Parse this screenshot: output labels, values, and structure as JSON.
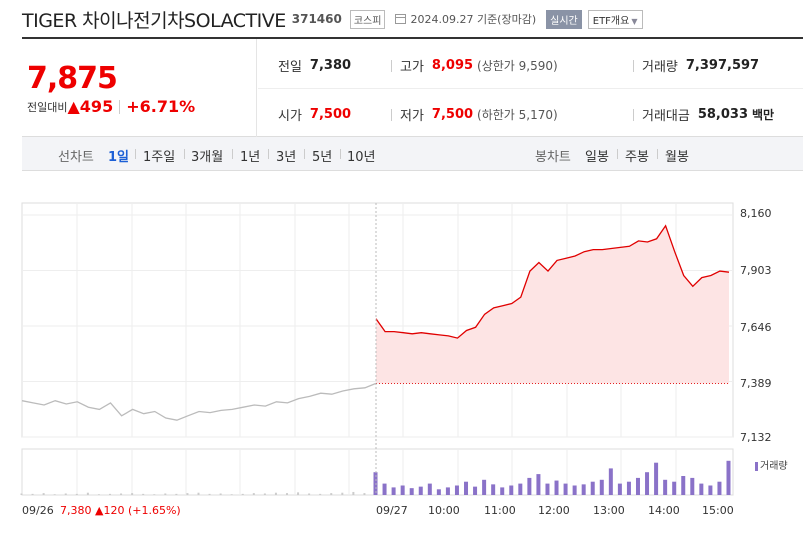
{
  "header": {
    "name": "TIGER 차이나전기차SOLACTIVE",
    "code": "371460",
    "market": "코스피",
    "datetime": "2024.09.27  기준(장마감)",
    "live": "실시간",
    "etf": "ETF개요"
  },
  "summary": {
    "price": "7,875",
    "change_label": "전일대비",
    "change_arrow": "▲",
    "change_value": "495",
    "change_rate": "+6.71%",
    "prev_label": "전일",
    "prev_value": "7,380",
    "high_label": "고가",
    "high_value": "8,095",
    "upper_limit": "(상한가 9,590)",
    "volume_label": "거래량",
    "volume_value": "7,397,597",
    "open_label": "시가",
    "open_value": "7,500",
    "low_label": "저가",
    "low_value": "7,500",
    "lower_limit": "(하한가 5,170)",
    "amount_label": "거래대금",
    "amount_value": "58,033",
    "amount_unit": "백만"
  },
  "tabs": {
    "line_label": "선차트",
    "periods": [
      "1일",
      "1주일",
      "3개월",
      "1년",
      "3년",
      "5년",
      "10년"
    ],
    "candle_label": "봉차트",
    "candles": [
      "일봉",
      "주봉",
      "월봉"
    ]
  },
  "colors": {
    "up": "#e00000",
    "prev": "#bbbbbb",
    "volume": "#8a72c8",
    "active_tab": "#1c5fd6"
  },
  "chart_data": {
    "type": "line",
    "ylim": [
      7132,
      8160
    ],
    "yticks": [
      "8,160",
      "7,903",
      "7,646",
      "7,389",
      "7,132"
    ],
    "xticks": [
      "09/26",
      "09/27",
      "10:00",
      "11:00",
      "12:00",
      "13:00",
      "14:00",
      "15:00"
    ],
    "baseline": 7380,
    "prev_day": {
      "name": "09/26",
      "values": [
        7300,
        7290,
        7280,
        7300,
        7285,
        7295,
        7270,
        7260,
        7290,
        7230,
        7260,
        7240,
        7250,
        7220,
        7210,
        7230,
        7250,
        7245,
        7255,
        7260,
        7270,
        7280,
        7275,
        7295,
        7290,
        7310,
        7320,
        7335,
        7330,
        7345,
        7355,
        7360,
        7380
      ]
    },
    "today": {
      "name": "09/27",
      "times": [
        "09:00",
        "09:10",
        "09:20",
        "09:30",
        "09:40",
        "09:50",
        "10:00",
        "10:10",
        "10:20",
        "10:30",
        "10:40",
        "10:50",
        "11:00",
        "11:10",
        "11:20",
        "11:30",
        "11:40",
        "11:50",
        "12:00",
        "12:10",
        "12:20",
        "12:30",
        "12:40",
        "12:50",
        "13:00",
        "13:10",
        "13:20",
        "13:30",
        "13:40",
        "13:50",
        "14:00",
        "14:10",
        "14:20",
        "14:30",
        "14:40",
        "14:50",
        "15:00",
        "15:10",
        "15:20",
        "15:30"
      ],
      "values": [
        7680,
        7620,
        7620,
        7615,
        7610,
        7615,
        7610,
        7605,
        7600,
        7590,
        7625,
        7640,
        7700,
        7730,
        7740,
        7750,
        7780,
        7900,
        7940,
        7900,
        7950,
        7960,
        7970,
        7990,
        8000,
        8000,
        8005,
        8010,
        8015,
        8040,
        8035,
        8050,
        8110,
        7990,
        7880,
        7830,
        7870,
        7880,
        7900,
        7895
      ]
    },
    "volume_label": "거래량",
    "prev_day_volume": [
      4,
      3,
      5,
      2,
      4,
      3,
      6,
      2,
      3,
      4,
      5,
      3,
      2,
      4,
      3,
      5,
      6,
      3,
      4,
      2,
      3,
      5,
      4,
      6,
      5,
      7,
      4,
      3,
      5,
      6,
      8,
      5,
      6
    ],
    "today_volume": [
      60,
      30,
      20,
      25,
      18,
      22,
      30,
      15,
      20,
      25,
      35,
      22,
      40,
      28,
      20,
      25,
      30,
      45,
      55,
      30,
      38,
      30,
      25,
      28,
      35,
      40,
      70,
      30,
      35,
      45,
      60,
      85,
      40,
      35,
      50,
      45,
      30,
      25,
      35,
      90
    ]
  },
  "footer": {
    "date": "09/26",
    "price": "7,380",
    "arrow": "▲",
    "change": "120",
    "rate": "(+1.65%)"
  }
}
